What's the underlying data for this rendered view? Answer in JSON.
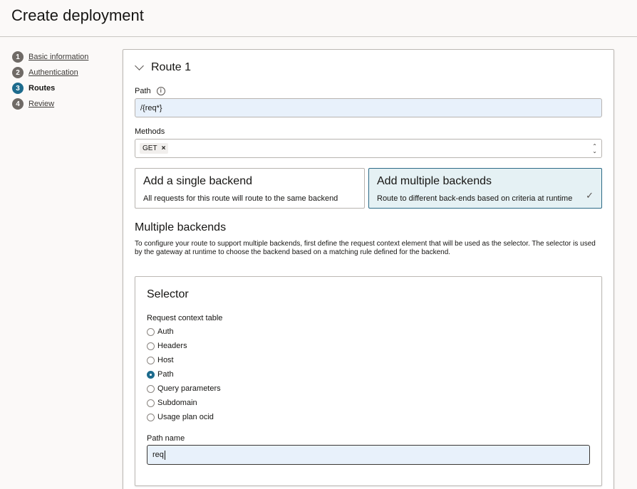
{
  "page": {
    "title": "Create deployment"
  },
  "steps": [
    {
      "num": "1",
      "label": "Basic information"
    },
    {
      "num": "2",
      "label": "Authentication"
    },
    {
      "num": "3",
      "label": "Routes"
    },
    {
      "num": "4",
      "label": "Review"
    }
  ],
  "route": {
    "title": "Route 1",
    "path_label": "Path",
    "path_value": "/{req*}",
    "methods_label": "Methods",
    "methods_chip": "GET",
    "chip_remove": "×"
  },
  "backend_options": {
    "single": {
      "title": "Add a single backend",
      "desc": "All requests for this route will route to the same backend"
    },
    "multiple": {
      "title": "Add multiple backends",
      "desc": "Route to different back-ends based on criteria at runtime",
      "check": "✓"
    }
  },
  "multiple_backends": {
    "title": "Multiple backends",
    "description": "To configure your route to support multiple backends, first define the request context element that will be used as the selector. The selector is used by the gateway at runtime to choose the backend based on a matching rule defined for the backend."
  },
  "selector": {
    "title": "Selector",
    "table_label": "Request context table",
    "options": [
      "Auth",
      "Headers",
      "Host",
      "Path",
      "Query parameters",
      "Subdomain",
      "Usage plan ocid"
    ],
    "selected": "Path",
    "path_name_label": "Path name",
    "path_name_value": "req"
  },
  "colors": {
    "accent": "#1d6b8d",
    "selected_card_bg": "#e5f1f4",
    "input_bg": "#e8f1fb"
  }
}
